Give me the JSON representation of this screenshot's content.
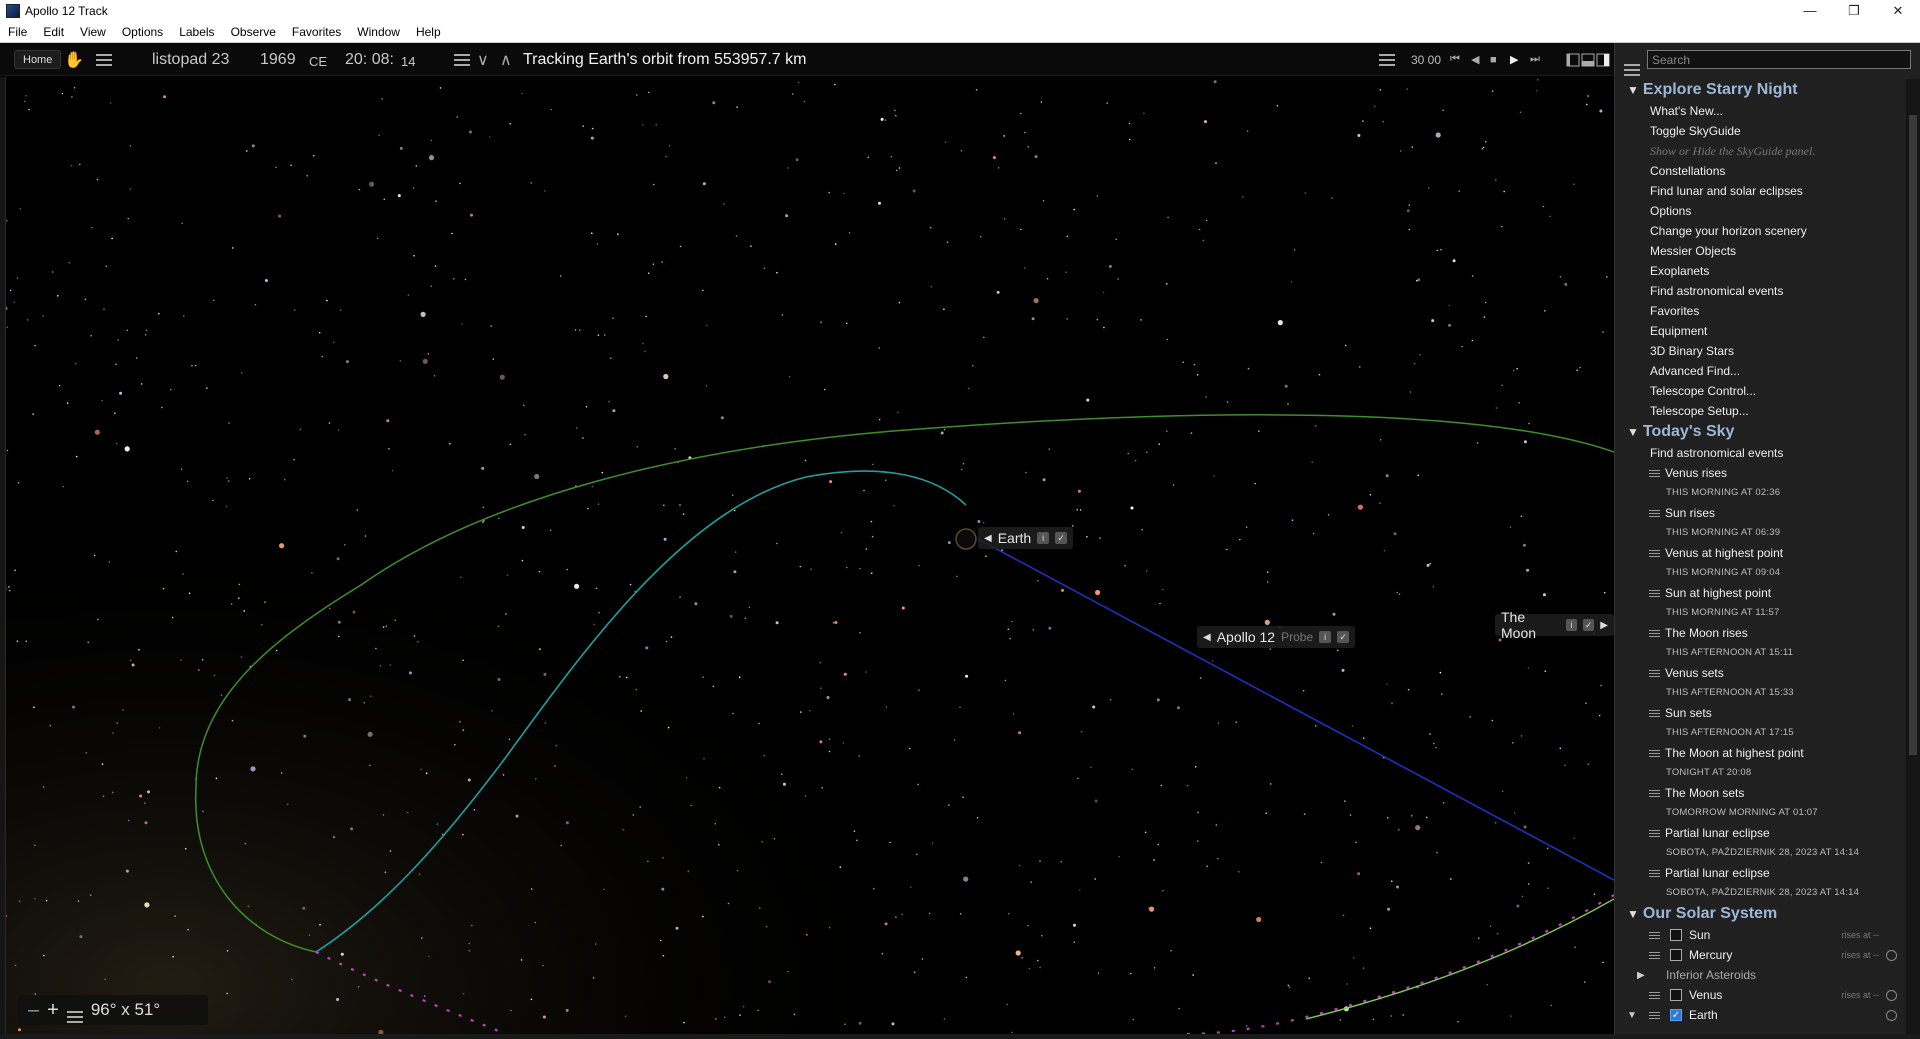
{
  "window": {
    "title": "Apollo 12 Track"
  },
  "menu": [
    "File",
    "Edit",
    "View",
    "Options",
    "Labels",
    "Observe",
    "Favorites",
    "Window",
    "Help"
  ],
  "toolbar": {
    "home_label": "Home",
    "date_month_day": "listopad 23",
    "date_year": "1969",
    "date_era": "CE",
    "time_hm": "20: 08:",
    "time_s": "14",
    "tracking_text": "Tracking Earth's orbit from 553957.7 km",
    "time_step": "30 00"
  },
  "sky": {
    "labels": {
      "earth": "Earth",
      "apollo": "Apollo 12",
      "apollo_type": "Probe",
      "moon": "The Moon"
    },
    "fov": "96° x 51°",
    "colors": {
      "outer_orbit": "#3f8f2a",
      "inner_orbit": "#1fa0a0",
      "track": "#2030b0",
      "moon_path": "#c040c0"
    }
  },
  "sidebar": {
    "search_placeholder": "Search",
    "explore": {
      "title": "Explore Starry Night",
      "items": [
        "What's New...",
        "Toggle SkyGuide"
      ],
      "hint": "Show or Hide the SkyGuide panel.",
      "items2": [
        "Constellations",
        "Find lunar and solar eclipses",
        "Options",
        "Change your horizon scenery",
        "Messier Objects",
        "Exoplanets",
        "Find astronomical events",
        "Favorites",
        "Equipment",
        "3D Binary Stars",
        "Advanced Find...",
        "Telescope Control...",
        "Telescope Setup..."
      ]
    },
    "today": {
      "title": "Today's Sky",
      "find_label": "Find astronomical events",
      "events": [
        {
          "name": "Venus rises",
          "when": "THIS MORNING AT 02:36"
        },
        {
          "name": "Sun rises",
          "when": "THIS MORNING AT 06:39"
        },
        {
          "name": "Venus at highest point",
          "when": "THIS MORNING AT 09:04"
        },
        {
          "name": "Sun at highest point",
          "when": "THIS MORNING AT 11:57"
        },
        {
          "name": "The Moon rises",
          "when": "THIS AFTERNOON AT 15:11"
        },
        {
          "name": "Venus sets",
          "when": "THIS AFTERNOON AT 15:33"
        },
        {
          "name": "Sun sets",
          "when": "THIS AFTERNOON AT 17:15"
        },
        {
          "name": "The Moon at highest point",
          "when": "TONIGHT AT 20:08"
        },
        {
          "name": "The Moon sets",
          "when": "TOMORROW MORNING AT 01:07"
        },
        {
          "name": "Partial lunar eclipse",
          "when": "SOBOTA, PAŹDZIERNIK 28, 2023 AT 14:14"
        },
        {
          "name": "Partial lunar eclipse",
          "when": "SOBOTA, PAŹDZIERNIK 28, 2023 AT 14:14"
        }
      ]
    },
    "solar": {
      "title": "Our Solar System",
      "rises_text": "rises at --",
      "objects": [
        "Sun",
        "Mercury",
        "Inferior Asteroids",
        "Venus",
        "Earth"
      ]
    }
  }
}
